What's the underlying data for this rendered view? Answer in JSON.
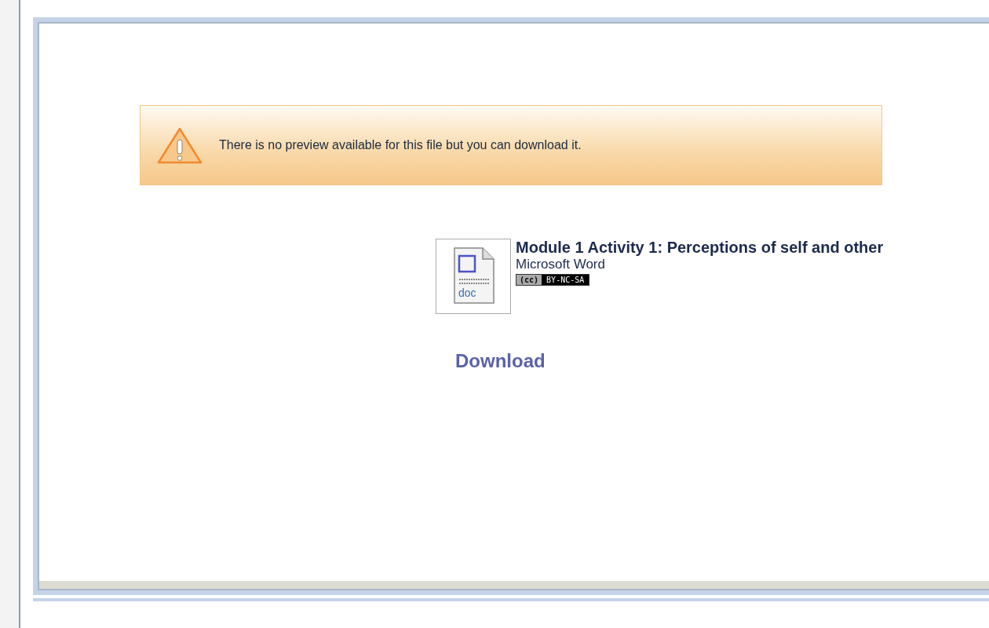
{
  "notice": {
    "message": "There is no preview available for this file but you can download it."
  },
  "file": {
    "title": "Module 1 Activity 1: Perceptions of self and other",
    "type": "Microsoft Word",
    "icon_label": "doc",
    "license": {
      "badge": "(cc)",
      "terms": "BY-NC-SA"
    }
  },
  "download": {
    "label": "Download"
  }
}
